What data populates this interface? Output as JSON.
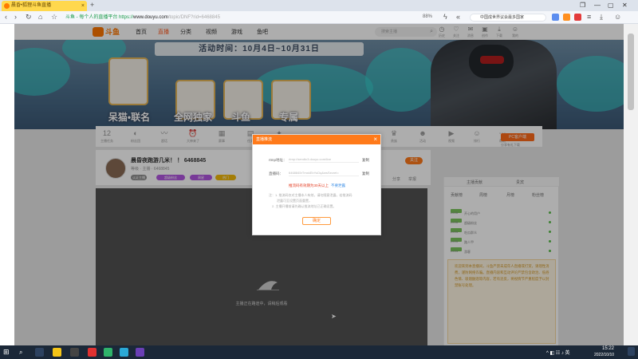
{
  "browser": {
    "tab_title": "晨昏•狐狸斗鱼直播",
    "new_tab": "+",
    "url_secure": "斗鱼 - 每个人的直播平台 https://",
    "url_host": "www.douyu.com",
    "url_path": "/topic/DNF?rid=6468845",
    "zoom": "88%",
    "search_text": "中国成世界议会最多国家",
    "window_controls": [
      "❐",
      "—",
      "▢",
      "✕"
    ]
  },
  "site_nav": {
    "logo": "斗鱼",
    "items": [
      "首页",
      "直播",
      "分类",
      "视频",
      "游戏",
      "鱼吧"
    ],
    "search_placeholder": "搜索主播",
    "tools": [
      "历史",
      "关注",
      "消息",
      "创作",
      "下载",
      "我的"
    ]
  },
  "banner": {
    "title": "活动时间：10月4日~10月31日",
    "prizes": [
      "呆猫•联名",
      "全网独家",
      "斗鱼",
      "专属"
    ]
  },
  "toolbar": {
    "count": "12",
    "items": [
      "主播任务",
      "粉丝团",
      "超话",
      "大神来了",
      "赛事",
      "任务",
      "签到",
      "贵族",
      "活动",
      "视频",
      "排行",
      "帮助"
    ],
    "pc_button": "PC客户端",
    "pc_sub": "分享有礼下载"
  },
  "room": {
    "title": "晨昏夜跑游几米！ ！ 6468845",
    "meta": "等级  ·  主播  ·  6468845",
    "badges": [
      "认证主播",
      "超级粉丝",
      "周星",
      "热门"
    ],
    "follow": "关注",
    "share": [
      "分享",
      "举报"
    ]
  },
  "player": {
    "message": "主播正在路途中，请稍后观看"
  },
  "sidepanel": {
    "header": [
      "主播贡献",
      "贵宾"
    ],
    "tabs": [
      "贡献榜",
      "周榜",
      "月榜",
      "粉丝榜"
    ],
    "rank": [
      {
        "lv": "LV28",
        "name": "开心的用户"
      },
      {
        "lv": "LV28",
        "name": "超级粉丝"
      },
      {
        "lv": "LV25",
        "name": "吃瓜群众"
      },
      {
        "lv": "LV25",
        "name": "路人甲"
      },
      {
        "lv": "LV24",
        "name": "游客"
      }
    ],
    "notice": "欢迎来到本直播间，斗鱼严禁未成年人直播或打赏，请理性消费，谨防网络诈骗。直播内容和互动评论严禁包含政治、低俗色情、吸烟酗酒等内容，若有违反，将视情节严重程度予以封禁账号处理。"
  },
  "modal": {
    "title": "直播推流",
    "rtmp_label": "rtmp地址：",
    "rtmp_value": "rtmp://sendtc3.douyu.com/live",
    "code_label": "直播码：",
    "code_value": "6468845rTmxkEbYuDq&wsSecret=",
    "copy": "复制",
    "warning": "推流码有效期为30天以上",
    "warning_link": "不要泄露",
    "notes": [
      "注：1. 推流码仅对主播本人有效，请勿随意泄露。若推流码",
      "泄露可至设置页面重置，",
      "2. 主播开播前请先确认推流地址已正确设置。"
    ],
    "confirm": "确定"
  },
  "taskbar": {
    "time": "15:22",
    "date": "2022/10/10"
  },
  "colors": {
    "accent": "#ff7a1a",
    "banner": "#4d6f8c",
    "taskbar": "#1b2838"
  }
}
